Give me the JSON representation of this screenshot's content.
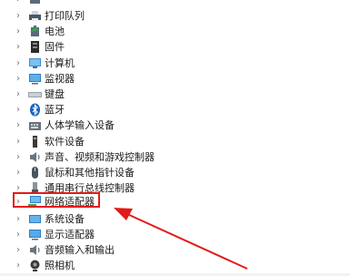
{
  "device_tree": {
    "items": [
      {
        "label": "",
        "icon": "device-icon"
      },
      {
        "label": "打印队列",
        "icon": "printer-icon"
      },
      {
        "label": "电池",
        "icon": "battery-icon"
      },
      {
        "label": "固件",
        "icon": "firmware-icon"
      },
      {
        "label": "计算机",
        "icon": "computer-icon"
      },
      {
        "label": "监视器",
        "icon": "monitor-icon"
      },
      {
        "label": "键盘",
        "icon": "keyboard-icon"
      },
      {
        "label": "蓝牙",
        "icon": "bluetooth-icon"
      },
      {
        "label": "人体学输入设备",
        "icon": "hid-icon"
      },
      {
        "label": "软件设备",
        "icon": "software-device-icon"
      },
      {
        "label": "声音、视频和游戏控制器",
        "icon": "speaker-icon"
      },
      {
        "label": "鼠标和其他指针设备",
        "icon": "mouse-icon"
      },
      {
        "label": "通用串行总线控制器",
        "icon": "usb-icon"
      },
      {
        "label": "网络适配器",
        "icon": "network-adapter-icon"
      },
      {
        "label": "系统设备",
        "icon": "system-device-icon"
      },
      {
        "label": "显示适配器",
        "icon": "display-adapter-icon"
      },
      {
        "label": "音频输入和输出",
        "icon": "audio-icon"
      },
      {
        "label": "照相机",
        "icon": "camera-icon"
      }
    ],
    "chevron": "›"
  },
  "annotation": {
    "highlight_color": "#e21b1b",
    "highlighted_item": "网络适配器"
  }
}
